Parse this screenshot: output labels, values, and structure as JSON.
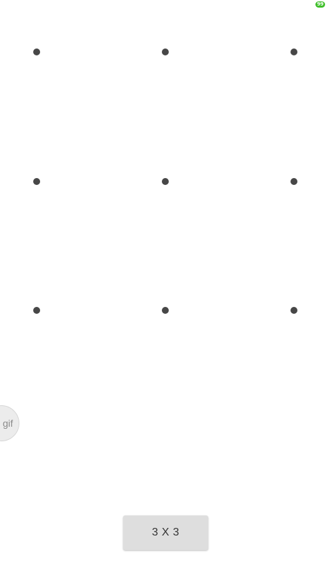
{
  "status_bar": {
    "battery_level": "99",
    "battery_color": "#3fbf2a",
    "battery_icon": "battery-icon"
  },
  "pattern": {
    "rows": 3,
    "cols": 3,
    "dot_color": "#474747"
  },
  "gif_button": {
    "label": "gif"
  },
  "grid_size_button": {
    "label": "3 X 3"
  }
}
